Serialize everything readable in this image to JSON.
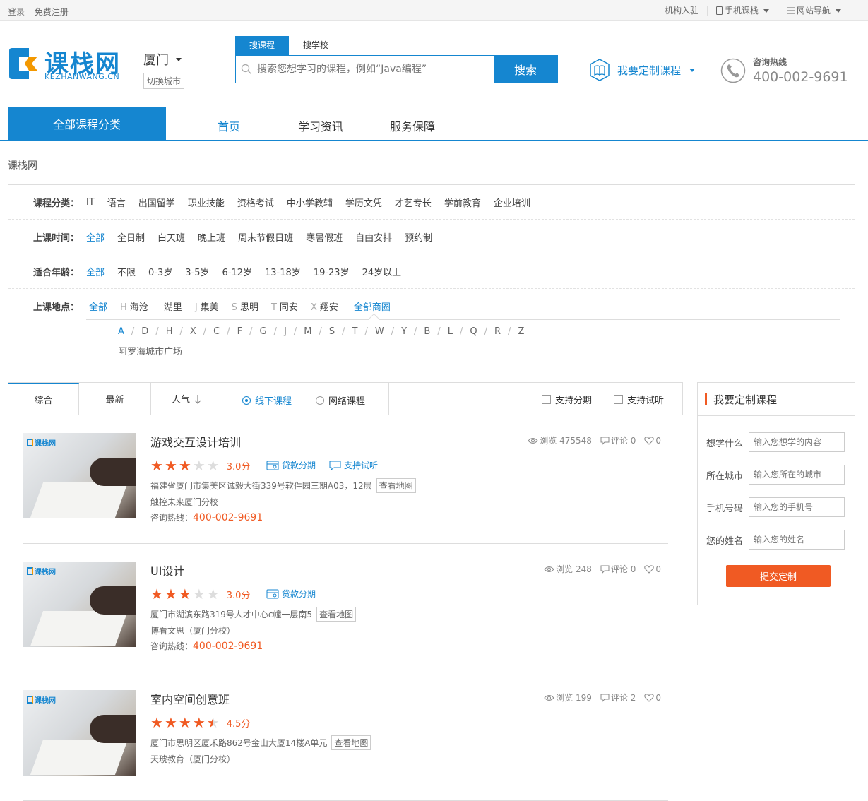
{
  "topbar": {
    "login": "登录",
    "register": "免费注册",
    "org_join": "机构入驻",
    "mobile": "手机课栈",
    "site_nav": "网站导航"
  },
  "logo": {
    "name": "课栈网",
    "sub": "KEZHANWANG.CN"
  },
  "city": {
    "current": "厦门",
    "switch": "切换城市"
  },
  "search": {
    "tabs": [
      "搜课程",
      "搜学校"
    ],
    "placeholder": "搜索您想学习的课程，例如“Java编程”",
    "button": "搜索"
  },
  "custom_course": "我要定制课程",
  "hotline": {
    "label": "咨询热线",
    "number": "400-002-9691"
  },
  "nav": {
    "all": "全部课程分类",
    "items": [
      "首页",
      "学习资讯",
      "服务保障"
    ]
  },
  "breadcrumb": "课栈网",
  "filters": {
    "category": {
      "label": "课程分类：",
      "options": [
        "IT",
        "语言",
        "出国留学",
        "职业技能",
        "资格考试",
        "中小学教辅",
        "学历文凭",
        "才艺专长",
        "学前教育",
        "企业培训"
      ]
    },
    "time": {
      "label": "上课时间：",
      "options": [
        "全部",
        "全日制",
        "白天班",
        "晚上班",
        "周末节假日班",
        "寒暑假班",
        "自由安排",
        "预约制"
      ]
    },
    "age": {
      "label": "适合年龄：",
      "options": [
        "全部",
        "不限",
        "0-3岁",
        "3-5岁",
        "6-12岁",
        "13-18岁",
        "19-23岁",
        "24岁以上"
      ]
    },
    "location": {
      "label": "上课地点：",
      "options": [
        {
          "pre": "",
          "text": "全部"
        },
        {
          "pre": "H",
          "text": "海沧"
        },
        {
          "pre": "",
          "text": "湖里"
        },
        {
          "pre": "J",
          "text": "集美"
        },
        {
          "pre": "S",
          "text": "思明"
        },
        {
          "pre": "T",
          "text": "同安"
        },
        {
          "pre": "X",
          "text": "翔安"
        },
        {
          "pre": "",
          "text": "全部商圈"
        }
      ],
      "letters": [
        "A",
        "D",
        "H",
        "X",
        "C",
        "F",
        "G",
        "J",
        "M",
        "S",
        "T",
        "W",
        "Y",
        "B",
        "L",
        "Q",
        "R",
        "Z"
      ],
      "mall": "阿罗海城市广场"
    }
  },
  "sort": {
    "composite": "综合",
    "newest": "最新",
    "popular": "人气",
    "offline": "线下课程",
    "online": "网络课程",
    "installment": "支持分期",
    "trial": "支持试听"
  },
  "courses": [
    {
      "title": "游戏交互设计培训",
      "views": "浏览 475548",
      "comments": "评论 0",
      "likes": "0",
      "rating": 3.0,
      "score": "3.0分",
      "tag_loan": "贷款分期",
      "tag_trial": "支持试听",
      "address": "福建省厦门市集美区诚毅大街339号软件园三期A03，12层",
      "map": "查看地图",
      "school": "触控未来厦门分校",
      "phone_label": "咨询热线：",
      "phone": "400-002-9691"
    },
    {
      "title": "UI设计",
      "views": "浏览 248",
      "comments": "评论 0",
      "likes": "0",
      "rating": 3.0,
      "score": "3.0分",
      "tag_loan": "贷款分期",
      "address": "厦门市湖滨东路319号人才中心c幢一层南5",
      "map": "查看地图",
      "school": "博看文思（厦门分校）",
      "phone_label": "咨询热线：",
      "phone": "400-002-9691"
    },
    {
      "title": "室内空间创意班",
      "views": "浏览 199",
      "comments": "评论 2",
      "likes": "0",
      "rating": 4.5,
      "score": "4.5分",
      "address": "厦门市思明区厦禾路862号金山大厦14楼A单元",
      "map": "查看地图",
      "school": "天琥教育（厦门分校）"
    }
  ],
  "thumb_logo": "课栈网",
  "form": {
    "title": "我要定制课程",
    "fields": [
      {
        "label": "想学什么",
        "placeholder": "输入您想学的内容"
      },
      {
        "label": "所在城市",
        "placeholder": "输入您所在的城市"
      },
      {
        "label": "手机号码",
        "placeholder": "输入您的手机号"
      },
      {
        "label": "您的姓名",
        "placeholder": "输入您的姓名"
      }
    ],
    "submit": "提交定制"
  },
  "colors": {
    "brand": "#1586d0",
    "accent": "#f05a23"
  }
}
